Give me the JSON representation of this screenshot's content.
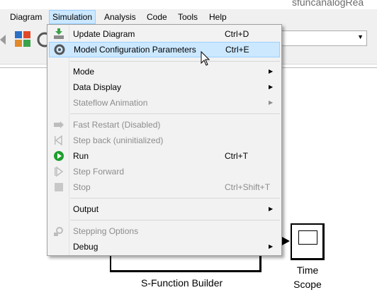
{
  "window": {
    "title": "sfuncanalogRea"
  },
  "menubar": {
    "items": [
      {
        "label": "Diagram",
        "active": false
      },
      {
        "label": "Simulation",
        "active": true
      },
      {
        "label": "Analysis",
        "active": false
      },
      {
        "label": "Code",
        "active": false
      },
      {
        "label": "Tools",
        "active": false
      },
      {
        "label": "Help",
        "active": false
      }
    ]
  },
  "simulation_menu": {
    "items": [
      {
        "label": "Update Diagram",
        "shortcut": "Ctrl+D",
        "icon": "update-diagram-icon",
        "enabled": true,
        "highlighted": false
      },
      {
        "label": "Model Configuration Parameters",
        "shortcut": "Ctrl+E",
        "icon": "gear-icon",
        "enabled": true,
        "highlighted": true
      },
      {
        "label": "Mode",
        "submenu": true,
        "enabled": true
      },
      {
        "label": "Data Display",
        "submenu": true,
        "enabled": true
      },
      {
        "label": "Stateflow Animation",
        "submenu": true,
        "enabled": false
      },
      {
        "label": "Fast Restart (Disabled)",
        "icon": "fast-restart-icon",
        "enabled": false
      },
      {
        "label": "Step back (uninitialized)",
        "icon": "step-back-icon",
        "enabled": false
      },
      {
        "label": "Run",
        "shortcut": "Ctrl+T",
        "icon": "run-icon",
        "enabled": true
      },
      {
        "label": "Step Forward",
        "icon": "step-forward-icon",
        "enabled": false
      },
      {
        "label": "Stop",
        "shortcut": "Ctrl+Shift+T",
        "icon": "stop-icon",
        "enabled": false
      },
      {
        "label": "Output",
        "submenu": true,
        "enabled": true
      },
      {
        "label": "Stepping Options",
        "icon": "stepping-options-icon",
        "enabled": false
      },
      {
        "label": "Debug",
        "submenu": true,
        "enabled": true
      }
    ]
  },
  "canvas": {
    "sfunction_block_label": "S-Function Builder",
    "scope_label_line1": "Time",
    "scope_label_line2": "Scope"
  },
  "colors": {
    "highlight": "#cce8ff",
    "highlight_border": "#99d1ff",
    "run_green": "#1e9e2e"
  }
}
